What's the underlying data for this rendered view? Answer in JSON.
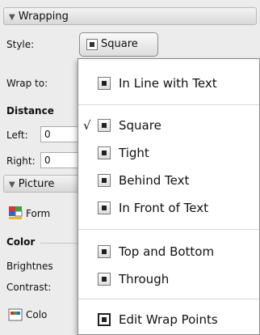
{
  "wrapping": {
    "header": "Wrapping",
    "style_label": "Style:",
    "style_value": "Square",
    "wrap_to_label": "Wrap to:",
    "distance_label": "Distance",
    "left_label": "Left:",
    "left_value": "0",
    "right_label": "Right:",
    "right_value": "0"
  },
  "picture": {
    "header": "Picture",
    "format_label": "Form",
    "color_label": "Color",
    "brightness_label": "Brightnes",
    "contrast_label": "Contrast:",
    "color_button_label": "Colo"
  },
  "menu": {
    "items": [
      {
        "label": "In Line with Text",
        "checked": false
      },
      {
        "label": "Square",
        "checked": true
      },
      {
        "label": "Tight",
        "checked": false
      },
      {
        "label": "Behind Text",
        "checked": false
      },
      {
        "label": "In Front of Text",
        "checked": false
      },
      {
        "label": "Top and Bottom",
        "checked": false
      },
      {
        "label": "Through",
        "checked": false
      },
      {
        "label": "Edit Wrap Points",
        "checked": false
      }
    ],
    "check_mark": "√"
  }
}
